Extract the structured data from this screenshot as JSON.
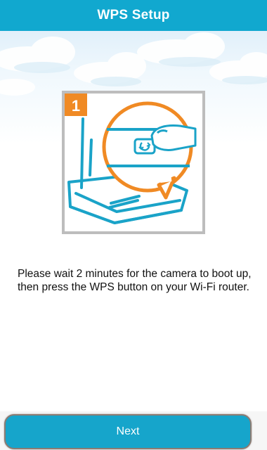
{
  "header": {
    "title": "WPS Setup"
  },
  "step": {
    "number": "1"
  },
  "instructions": "Please wait 2 minutes for the camera to boot up, then press the WPS button on your Wi-Fi router.",
  "footer": {
    "next_label": "Next"
  },
  "colors": {
    "header_bg": "#11a8cf",
    "accent_orange": "#f08a24",
    "router_blue": "#1aa3c8",
    "button_bg": "#16a5cb"
  },
  "icons": [
    "wps-button-icon",
    "finger-icon",
    "router-icon"
  ]
}
